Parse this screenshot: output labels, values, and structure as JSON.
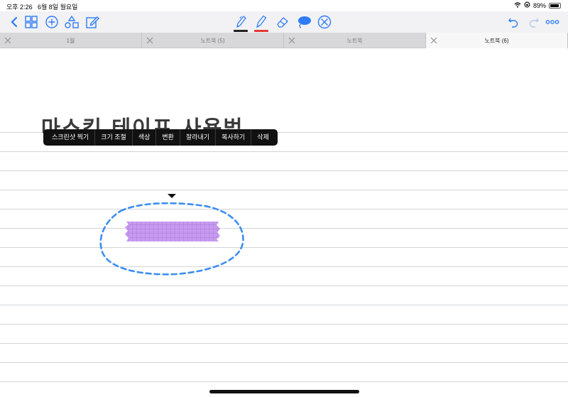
{
  "status": {
    "time": "오후 2:26",
    "date": "6월 8일 월요일",
    "battery": "89%"
  },
  "toolbar": {
    "left_icons": [
      "back-chevron-icon",
      "grid-view-icon",
      "add-circle-icon",
      "shapes-icon",
      "edit-note-icon"
    ],
    "center_tools": [
      "pen-tool-icon",
      "highlighter-tool-icon",
      "eraser-tool-icon",
      "lasso-tool-icon",
      "cancel-circle-icon"
    ],
    "pen_color": "#222222",
    "highlighter_color": "#e53935",
    "accent": "#2f7cf6",
    "right_icons": [
      "undo-icon",
      "redo-icon",
      "more-icon"
    ]
  },
  "tabs": [
    {
      "label": "1월",
      "active": false
    },
    {
      "label": "노트북 (5)",
      "active": false
    },
    {
      "label": "노트북",
      "active": false
    },
    {
      "label": "노트북 (6)",
      "active": true
    }
  ],
  "page": {
    "title": "마스킹 테이프 사용법",
    "tape_color": "#c79af0",
    "lasso_color": "#3d8ef0"
  },
  "context_menu": {
    "items": [
      "스크린샷 찍기",
      "크기 조절",
      "색상",
      "변환",
      "잘라내기",
      "복사하기",
      "삭제"
    ]
  }
}
